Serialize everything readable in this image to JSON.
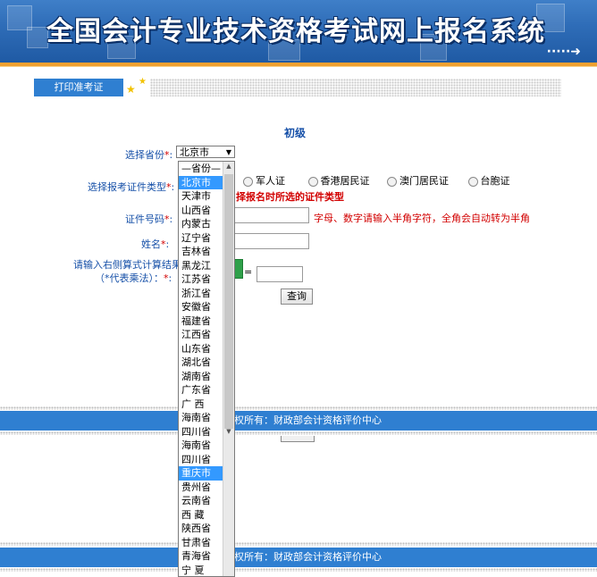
{
  "header": {
    "title": "全国会计专业技术资格考试网上报名系统",
    "arrow": "·····➜"
  },
  "tab": {
    "label": "打印准考证",
    "star": "★"
  },
  "form": {
    "level": "初级",
    "province_label": "选择省份",
    "required_mark": "*",
    "colon": ":",
    "province_value": "北京市",
    "id_type_label": "选择报考证件类型",
    "id_type_options": [
      "军人证",
      "香港居民证",
      "澳门居民证",
      "台胞证"
    ],
    "id_type_hint": "择报名时所选的证件类型",
    "id_number_label": "证件号码",
    "id_number_hint": "字母、数字请输入半角字符，全角会自动转为半角",
    "name_label": "姓名",
    "calc_label_line1": "请输入右侧算式计算结果",
    "calc_label_line2": "（*代表乘法）：",
    "equals": "=",
    "query_button": "查询"
  },
  "dropdown": {
    "options": [
      "—省份—",
      "北京市",
      "天津市",
      "山西省",
      "内蒙古",
      "辽宁省",
      "吉林省",
      "黑龙江",
      "江苏省",
      "浙江省",
      "安徽省",
      "福建省",
      "江西省",
      "山东省",
      "湖北省",
      "湖南省",
      "广东省",
      "广 西",
      "海南省",
      "四川省",
      "海南省",
      "四川省",
      "重庆市",
      "贵州省",
      "云南省",
      "西 藏",
      "陕西省",
      "甘肃省",
      "青海省",
      "宁 夏"
    ],
    "selected": [
      "北京市",
      "重庆市"
    ]
  },
  "footer": {
    "text": "权所有：财政部会计资格评价中心"
  }
}
